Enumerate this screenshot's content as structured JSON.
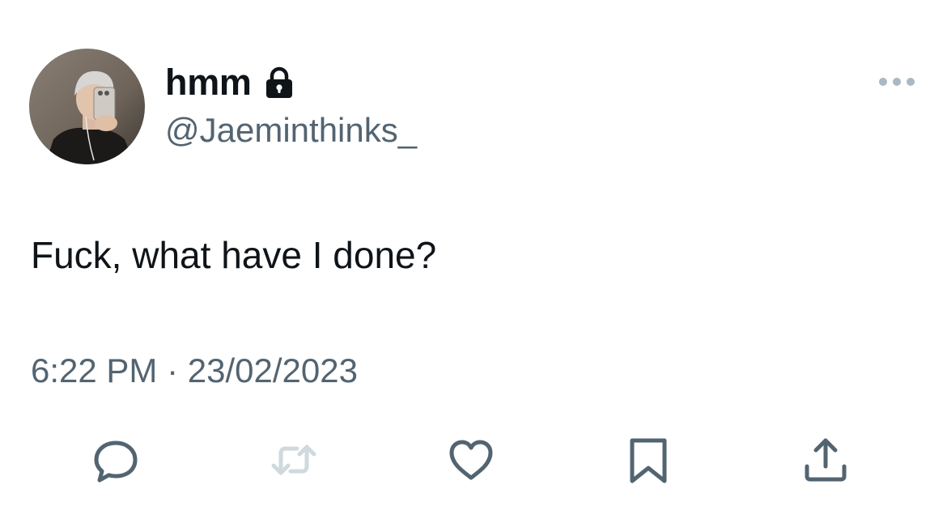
{
  "author": {
    "display_name": "hmm",
    "handle": "@Jaeminthinks_",
    "avatar": "profile-photo",
    "protected_icon": "lock-icon"
  },
  "tweet": {
    "text": "Fuck, what have I done?",
    "timestamp": "6:22 PM · 23/02/2023"
  },
  "menu": {
    "icon": "more-horizontal-icon"
  },
  "actions": [
    {
      "name": "reply",
      "icon": "reply-icon"
    },
    {
      "name": "retweet",
      "icon": "retweet-icon",
      "disabled": true
    },
    {
      "name": "like",
      "icon": "heart-icon"
    },
    {
      "name": "bookmark",
      "icon": "bookmark-icon"
    },
    {
      "name": "share",
      "icon": "share-icon"
    }
  ],
  "colors": {
    "text_primary": "#0f1419",
    "text_secondary": "#536471",
    "icon_muted": "#cfd9de",
    "menu_dots": "#aab8c2"
  }
}
